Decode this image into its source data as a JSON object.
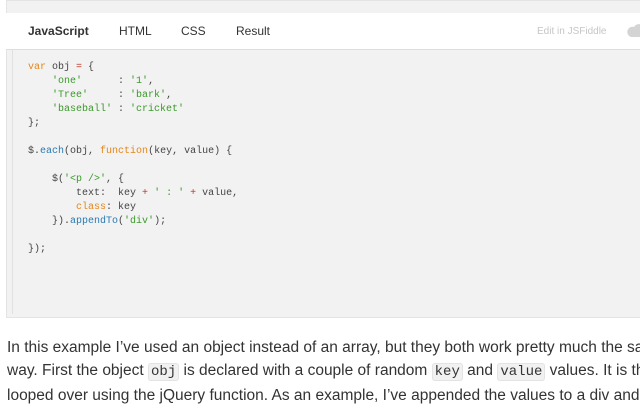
{
  "tabs": [
    {
      "label": "JavaScript",
      "active": true
    },
    {
      "label": "HTML",
      "active": false
    },
    {
      "label": "CSS",
      "active": false
    },
    {
      "label": "Result",
      "active": false
    }
  ],
  "edit_link": "Edit in JSFiddle",
  "icons": {
    "cloud": "cloud-icon"
  },
  "colors": {
    "keyword": "#e5861a",
    "string": "#3a9a2a",
    "function": "#2a7ab3",
    "operator": "#c0392b"
  },
  "code_lines": [
    [
      [
        "kw",
        "var"
      ],
      [
        "plain",
        " obj "
      ],
      [
        "op",
        "="
      ],
      [
        "plain",
        " {"
      ]
    ],
    [
      [
        "plain",
        "    "
      ],
      [
        "str",
        "'one'"
      ],
      [
        "plain",
        "      : "
      ],
      [
        "str",
        "'1'"
      ],
      [
        "plain",
        ","
      ]
    ],
    [
      [
        "plain",
        "    "
      ],
      [
        "str",
        "'Tree'"
      ],
      [
        "plain",
        "     : "
      ],
      [
        "str",
        "'bark'"
      ],
      [
        "plain",
        ","
      ]
    ],
    [
      [
        "plain",
        "    "
      ],
      [
        "str",
        "'baseball'"
      ],
      [
        "plain",
        " : "
      ],
      [
        "str",
        "'cricket'"
      ]
    ],
    [
      [
        "plain",
        "};"
      ]
    ],
    [
      [
        "plain",
        ""
      ]
    ],
    [
      [
        "plain",
        "$."
      ],
      [
        "fn",
        "each"
      ],
      [
        "plain",
        "(obj, "
      ],
      [
        "kw",
        "function"
      ],
      [
        "plain",
        "(key, value) {"
      ]
    ],
    [
      [
        "plain",
        ""
      ]
    ],
    [
      [
        "plain",
        "    $("
      ],
      [
        "str",
        "'<p />'"
      ],
      [
        "plain",
        ", {"
      ]
    ],
    [
      [
        "plain",
        "        text:  key "
      ],
      [
        "op",
        "+"
      ],
      [
        "plain",
        " "
      ],
      [
        "str",
        "' : '"
      ],
      [
        "plain",
        " "
      ],
      [
        "op",
        "+"
      ],
      [
        "plain",
        " value,"
      ]
    ],
    [
      [
        "plain",
        "        "
      ],
      [
        "kw",
        "class"
      ],
      [
        "plain",
        ": key"
      ]
    ],
    [
      [
        "plain",
        "    })."
      ],
      [
        "fn",
        "appendTo"
      ],
      [
        "plain",
        "("
      ],
      [
        "str",
        "'div'"
      ],
      [
        "plain",
        ");"
      ]
    ],
    [
      [
        "plain",
        ""
      ]
    ],
    [
      [
        "plain",
        "});"
      ]
    ]
  ],
  "prose": {
    "line1": "In this example I’ve used an object instead of an array, but they both work pretty much the same",
    "line2_a": "way. First the object ",
    "line2_code1": "obj",
    "line2_b": " is declared with a couple of random ",
    "line2_code2": "key",
    "line2_c": " and ",
    "line2_code3": "value",
    "line2_d": " values. It is then",
    "line3": "looped over using the jQuery function. As an example, I’ve appended the values to a div and"
  }
}
